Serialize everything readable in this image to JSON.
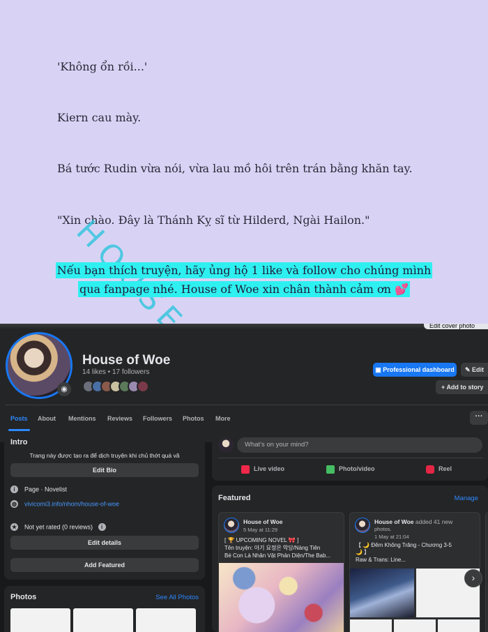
{
  "story": {
    "line1": "'Không ổn rồi...'",
    "line2": "Kiern cau mày.",
    "line3": "Bá tước Rudin vừa nói, vừa lau mồ hôi trên trán bằng khăn tay.",
    "line4": "\"Xin chào. Đây là Thánh Kỵ sĩ từ Hilderd, Ngài Hailon.\"",
    "highlight1": "Nếu bạn thích truyện, hãy ủng hộ 1 like và follow cho chúng mình",
    "highlight2": "qua fanpage nhé. House of Woe xin chân thành cảm ơn 💕",
    "watermark": "HOUSE OF"
  },
  "header": {
    "edit_cover": "Edit cover photo",
    "page_name": "House of Woe",
    "stats": "14 likes • 17 followers",
    "professional_dashboard": "Professional dashboard",
    "edit": "Edit",
    "add_to_story": "Add to story",
    "friend_colors": [
      "#6b6f7a",
      "#4a6fa5",
      "#8a5a4a",
      "#c9c1a0",
      "#5a7a5a",
      "#9a8ab0",
      "#7a3a4a"
    ]
  },
  "tabs": [
    "Posts",
    "About",
    "Mentions",
    "Reviews",
    "Followers",
    "Photos",
    "More ▾"
  ],
  "intro": {
    "title": "Intro",
    "bio": "Trang này được tạo ra để dịch truyện khi chủ thớt quá vã",
    "edit_bio": "Edit Bio",
    "page_type": "Page · Novelist",
    "website": "vivicomi3.info/nhom/house-of-woe",
    "rating": "Not yet rated (0 reviews)",
    "edit_details": "Edit details",
    "add_featured": "Add Featured"
  },
  "photos": {
    "title": "Photos",
    "see_all": "See All Photos"
  },
  "composer": {
    "placeholder": "What's on your mind?",
    "live_video": "Live video",
    "photo_video": "Photo/video",
    "reel": "Reel"
  },
  "featured": {
    "title": "Featured",
    "manage": "Manage",
    "posts": [
      {
        "author": "House of Woe",
        "added": "",
        "date": "5 May at 11:29",
        "text1": "[ 🏆 UPCOMING NOVEL 🎀 ]",
        "text2": "Tên truyện: 아기 요정은 악당/Nàng Tiên",
        "text3": "Bé Con Là Nhân Vật Phản Diện/The Bab..."
      },
      {
        "author": "House of Woe",
        "added": " added 41 new",
        "added2": "photos.",
        "date": "1 May at 21:04",
        "text1": "【 🌙 Đêm Không Trăng - Chương 3-5",
        "text2": "🌙 】",
        "text3": "Raw & Trans: Line..."
      }
    ]
  }
}
